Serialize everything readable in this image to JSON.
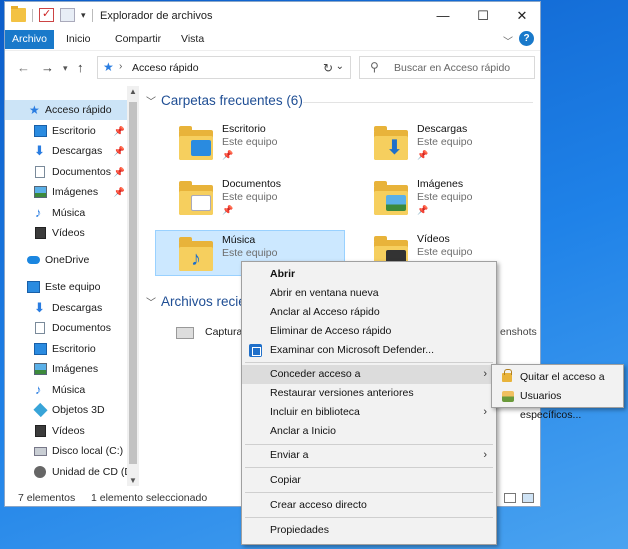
{
  "window": {
    "title": "Explorador de archivos",
    "controls": {
      "minimize": "—",
      "maximize": "☐",
      "close": "✕"
    }
  },
  "ribbon": {
    "tabs": [
      "Archivo",
      "Inicio",
      "Compartir",
      "Vista"
    ],
    "help": "?"
  },
  "address": {
    "location": "Acceso rápido",
    "search_placeholder": "Buscar en Acceso rápido"
  },
  "sidebar": {
    "items": [
      {
        "label": "Acceso rápido",
        "icon": "star-icon",
        "pinned": false
      },
      {
        "label": "Escritorio",
        "icon": "desktop-icon",
        "pinned": true
      },
      {
        "label": "Descargas",
        "icon": "downloads-icon",
        "pinned": true
      },
      {
        "label": "Documentos",
        "icon": "documents-icon",
        "pinned": true
      },
      {
        "label": "Imágenes",
        "icon": "pictures-icon",
        "pinned": true
      },
      {
        "label": "Música",
        "icon": "music-icon",
        "pinned": false
      },
      {
        "label": "Vídeos",
        "icon": "videos-icon",
        "pinned": false
      },
      {
        "label": "OneDrive",
        "icon": "cloud-icon",
        "pinned": false
      },
      {
        "label": "Este equipo",
        "icon": "computer-icon",
        "pinned": false
      },
      {
        "label": "Descargas",
        "icon": "downloads-icon",
        "pinned": false
      },
      {
        "label": "Documentos",
        "icon": "documents-icon",
        "pinned": false
      },
      {
        "label": "Escritorio",
        "icon": "desktop-icon",
        "pinned": false
      },
      {
        "label": "Imágenes",
        "icon": "pictures-icon",
        "pinned": false
      },
      {
        "label": "Música",
        "icon": "music-icon",
        "pinned": false
      },
      {
        "label": "Objetos 3D",
        "icon": "objects-3d-icon",
        "pinned": false
      },
      {
        "label": "Vídeos",
        "icon": "videos-icon",
        "pinned": false
      },
      {
        "label": "Disco local (C:)",
        "icon": "disk-icon",
        "pinned": false
      },
      {
        "label": "Unidad de CD (D",
        "icon": "cd-drive-icon",
        "pinned": false
      }
    ]
  },
  "frequent": {
    "header": "Carpetas frecuentes (6)",
    "folders": [
      {
        "name": "Escritorio",
        "location": "Este equipo"
      },
      {
        "name": "Descargas",
        "location": "Este equipo"
      },
      {
        "name": "Documentos",
        "location": "Este equipo"
      },
      {
        "name": "Imágenes",
        "location": "Este equipo"
      },
      {
        "name": "Música",
        "location": "Este equipo"
      },
      {
        "name": "Vídeos",
        "location": "Este equipo"
      }
    ]
  },
  "recent": {
    "header": "Archivos recien",
    "item": "Captura d",
    "item_right": "enshots"
  },
  "status": {
    "count": "7 elementos",
    "selected": "1 elemento seleccionado"
  },
  "context_menu": {
    "items": [
      "Abrir",
      "Abrir en ventana nueva",
      "Anclar al Acceso rápido",
      "Eliminar de Acceso rápido",
      "Examinar con Microsoft Defender...",
      "Conceder acceso a",
      "Restaurar versiones anteriores",
      "Incluir en biblioteca",
      "Anclar a Inicio",
      "Enviar a",
      "Copiar",
      "Crear acceso directo",
      "Propiedades"
    ]
  },
  "submenu": {
    "items": [
      "Quitar el acceso a",
      "Usuarios específicos..."
    ]
  },
  "colors": {
    "accent": "#1979ca",
    "selection": "#cce8ff",
    "header_text": "#1f4e94"
  }
}
